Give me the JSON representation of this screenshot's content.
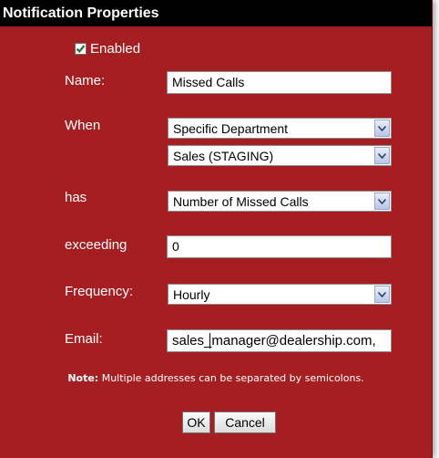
{
  "dialog": {
    "title": "Notification Properties"
  },
  "enabled": {
    "label": "Enabled",
    "checked": true
  },
  "form": {
    "name_label": "Name:",
    "name_value": "Missed Calls",
    "when_label": "When",
    "when_scope_value": "Specific Department",
    "when_department_value": "Sales (STAGING)",
    "has_label": "has",
    "has_value": "Number of Missed Calls",
    "exceeding_label": "exceeding",
    "exceeding_value": "0",
    "frequency_label": "Frequency:",
    "frequency_value": "Hourly",
    "email_label": "Email:",
    "email_value": "sales_manager@dealership.com,"
  },
  "note": {
    "prefix": "Note:",
    "text": " Multiple addresses can be separated by semicolons."
  },
  "buttons": {
    "ok": "OK",
    "cancel": "Cancel"
  },
  "icons": {
    "checkbox_check": "check-icon",
    "dropdown_arrow": "chevron-down-icon"
  }
}
